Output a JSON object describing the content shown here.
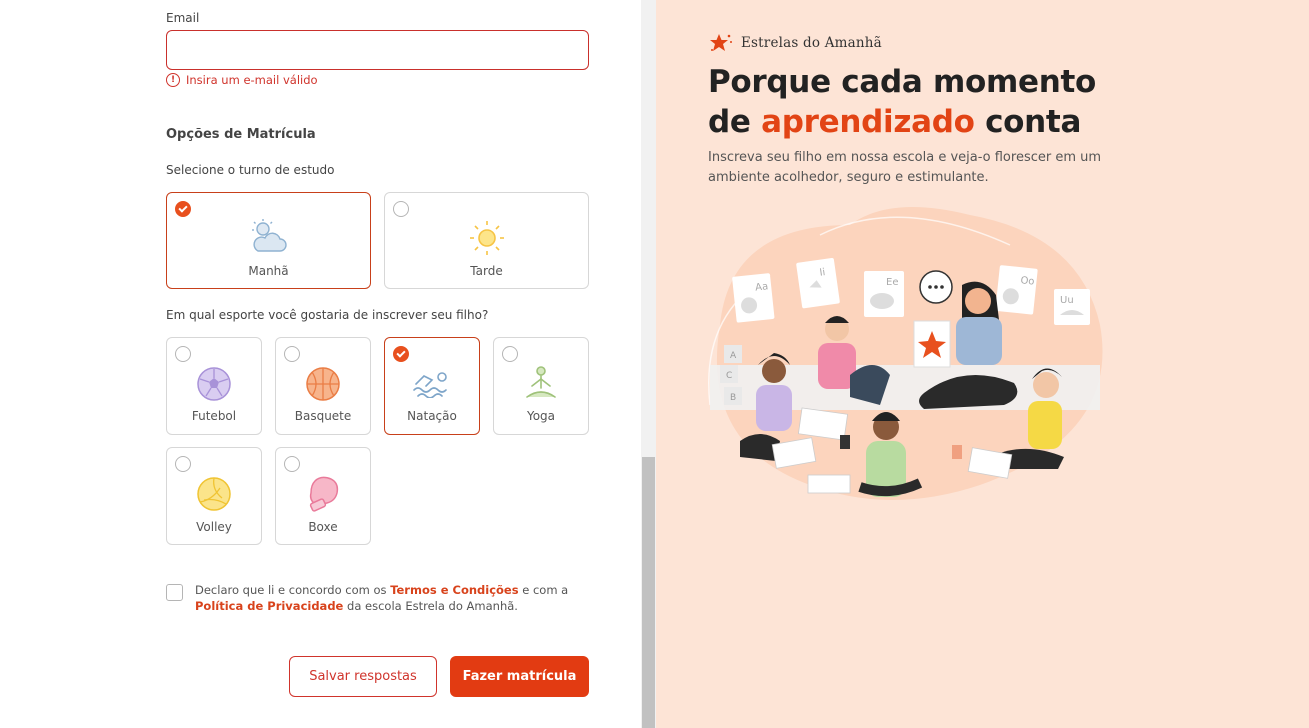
{
  "form": {
    "email": {
      "label": "Email",
      "value": "",
      "error": "Insira um e-mail válido"
    },
    "section_title": "Opções de Matrícula",
    "shift": {
      "question": "Selecione o turno de estudo",
      "options": [
        {
          "label": "Manhã",
          "selected": true,
          "icon": "cloud-sun-icon"
        },
        {
          "label": "Tarde",
          "selected": false,
          "icon": "sun-icon"
        }
      ]
    },
    "sport": {
      "question": "Em qual esporte você gostaria de inscrever seu filho?",
      "options": [
        {
          "label": "Futebol",
          "selected": false,
          "icon": "soccer-ball-icon"
        },
        {
          "label": "Basquete",
          "selected": false,
          "icon": "basketball-icon"
        },
        {
          "label": "Natação",
          "selected": true,
          "icon": "swimmer-icon"
        },
        {
          "label": "Yoga",
          "selected": false,
          "icon": "yoga-icon"
        },
        {
          "label": "Volley",
          "selected": false,
          "icon": "volleyball-icon"
        },
        {
          "label": "Boxe",
          "selected": false,
          "icon": "boxing-glove-icon"
        }
      ]
    },
    "terms": {
      "checked": false,
      "text_1": "Declaro que li e concordo com os",
      "link_terms": "Termos e Condições",
      "text_2": "e com a",
      "link_privacy": "Política de Privacidade",
      "text_3": "da escola Estrela do Amanhã."
    },
    "buttons": {
      "save": "Salvar respostas",
      "submit": "Fazer matrícula"
    }
  },
  "hero": {
    "brand": "Estrelas do Amanhã",
    "headline_1": "Porque cada momento",
    "headline_2_pre": "de",
    "headline_2_accent": "aprendizado",
    "headline_2_post": "conta",
    "subtitle": "Inscreva seu filho em nossa escola e veja-o florescer em um ambiente acolhedor, seguro e estimulante.",
    "illustration": {
      "cards": [
        "Aa",
        "Ii",
        "Ee",
        "Oo",
        "Uu"
      ],
      "blocks": [
        "A",
        "C",
        "B"
      ]
    }
  },
  "colors": {
    "accent": "#e23b12",
    "error": "#d0342c",
    "hero_bg": "#fde4d6"
  }
}
